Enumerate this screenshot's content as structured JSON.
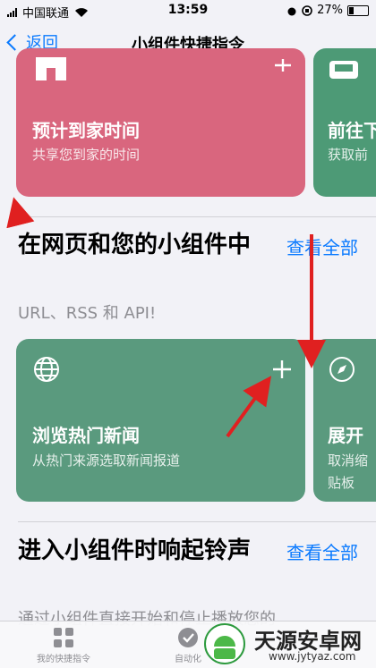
{
  "status": {
    "carrier": "中国联通",
    "time": "13:59",
    "battery": "27%",
    "battery_level": 0.27
  },
  "nav": {
    "back_label": "返回",
    "title": "小组件快捷指令"
  },
  "cards_top": [
    {
      "title": "预计到家时间",
      "subtitle": "共享您到家的时间",
      "color": "#d9667e"
    },
    {
      "title": "前往下",
      "subtitle": "获取前",
      "color": "#4d9a76"
    }
  ],
  "section1": {
    "title": "在网页和您的小组件中",
    "see_all": "查看全部",
    "subtitle": "URL、RSS 和 API!",
    "cards": [
      {
        "title": "浏览热门新闻",
        "subtitle": "从热门来源选取新闻报道",
        "color": "#5a9a7e",
        "icon": "globe-icon"
      },
      {
        "title": "展开",
        "subtitle_lines": [
          "取消缩",
          "贴板"
        ],
        "color": "#5a9a7e",
        "icon": "compass-icon"
      }
    ]
  },
  "section2": {
    "title": "进入小组件时响起铃声",
    "see_all": "查看全部",
    "subtitle": "通过小组件直接开始和停止播放您的"
  },
  "tabbar": {
    "items": [
      {
        "label": "我的快捷指令"
      },
      {
        "label": "自动化"
      }
    ]
  },
  "watermark": {
    "brand": "天源安卓网",
    "url": "www.jytyaz.com"
  }
}
